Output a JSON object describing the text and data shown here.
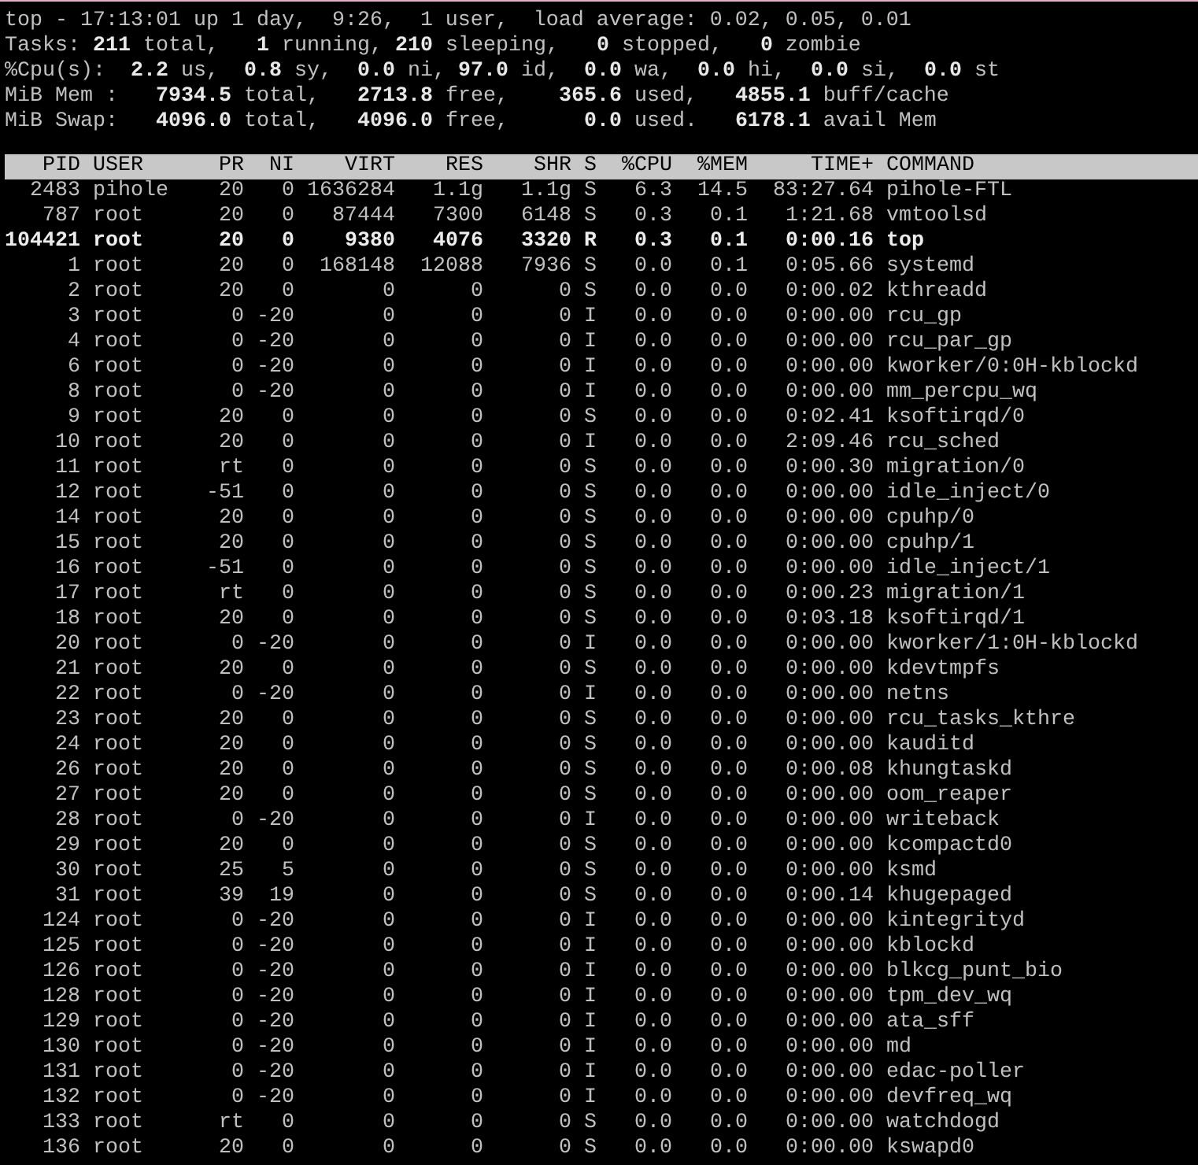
{
  "summary": [
    "top - 17:13:01 up 1 day,  9:26,  1 user,  load average: 0.02, 0.05, 0.01",
    "Tasks: **211** total,   **1** running, **210** sleeping,   **0** stopped,   **0** zombie",
    "%Cpu(s):  **2.2** us,  **0.8** sy,  **0.0** ni, **97.0** id,  **0.0** wa,  **0.0** hi,  **0.0** si,  **0.0** st",
    "MiB Mem :   **7934.5** total,   **2713.8** free,    **365.6** used,   **4855.1** buff/cache",
    "MiB Swap:   **4096.0** total,   **4096.0** free,      **0.0** used.   **6178.1** avail Mem"
  ],
  "table": {
    "columns": [
      "PID",
      "USER",
      "PR",
      "NI",
      "VIRT",
      "RES",
      "SHR",
      "S",
      "%CPU",
      "%MEM",
      "TIME+",
      "COMMAND"
    ],
    "rows": [
      {
        "highlighted": false,
        "cells": [
          "2483",
          "pihole",
          "20",
          "0",
          "1636284",
          "1.1g",
          "1.1g",
          "S",
          "6.3",
          "14.5",
          "83:27.64",
          "pihole-FTL"
        ]
      },
      {
        "highlighted": false,
        "cells": [
          "787",
          "root",
          "20",
          "0",
          "87444",
          "7300",
          "6148",
          "S",
          "0.3",
          "0.1",
          "1:21.68",
          "vmtoolsd"
        ]
      },
      {
        "highlighted": true,
        "cells": [
          "104421",
          "root",
          "20",
          "0",
          "9380",
          "4076",
          "3320",
          "R",
          "0.3",
          "0.1",
          "0:00.16",
          "top"
        ]
      },
      {
        "highlighted": false,
        "cells": [
          "1",
          "root",
          "20",
          "0",
          "168148",
          "12088",
          "7936",
          "S",
          "0.0",
          "0.1",
          "0:05.66",
          "systemd"
        ]
      },
      {
        "highlighted": false,
        "cells": [
          "2",
          "root",
          "20",
          "0",
          "0",
          "0",
          "0",
          "S",
          "0.0",
          "0.0",
          "0:00.02",
          "kthreadd"
        ]
      },
      {
        "highlighted": false,
        "cells": [
          "3",
          "root",
          "0",
          "-20",
          "0",
          "0",
          "0",
          "I",
          "0.0",
          "0.0",
          "0:00.00",
          "rcu_gp"
        ]
      },
      {
        "highlighted": false,
        "cells": [
          "4",
          "root",
          "0",
          "-20",
          "0",
          "0",
          "0",
          "I",
          "0.0",
          "0.0",
          "0:00.00",
          "rcu_par_gp"
        ]
      },
      {
        "highlighted": false,
        "cells": [
          "6",
          "root",
          "0",
          "-20",
          "0",
          "0",
          "0",
          "I",
          "0.0",
          "0.0",
          "0:00.00",
          "kworker/0:0H-kblockd"
        ]
      },
      {
        "highlighted": false,
        "cells": [
          "8",
          "root",
          "0",
          "-20",
          "0",
          "0",
          "0",
          "I",
          "0.0",
          "0.0",
          "0:00.00",
          "mm_percpu_wq"
        ]
      },
      {
        "highlighted": false,
        "cells": [
          "9",
          "root",
          "20",
          "0",
          "0",
          "0",
          "0",
          "S",
          "0.0",
          "0.0",
          "0:02.41",
          "ksoftirqd/0"
        ]
      },
      {
        "highlighted": false,
        "cells": [
          "10",
          "root",
          "20",
          "0",
          "0",
          "0",
          "0",
          "I",
          "0.0",
          "0.0",
          "2:09.46",
          "rcu_sched"
        ]
      },
      {
        "highlighted": false,
        "cells": [
          "11",
          "root",
          "rt",
          "0",
          "0",
          "0",
          "0",
          "S",
          "0.0",
          "0.0",
          "0:00.30",
          "migration/0"
        ]
      },
      {
        "highlighted": false,
        "cells": [
          "12",
          "root",
          "-51",
          "0",
          "0",
          "0",
          "0",
          "S",
          "0.0",
          "0.0",
          "0:00.00",
          "idle_inject/0"
        ]
      },
      {
        "highlighted": false,
        "cells": [
          "14",
          "root",
          "20",
          "0",
          "0",
          "0",
          "0",
          "S",
          "0.0",
          "0.0",
          "0:00.00",
          "cpuhp/0"
        ]
      },
      {
        "highlighted": false,
        "cells": [
          "15",
          "root",
          "20",
          "0",
          "0",
          "0",
          "0",
          "S",
          "0.0",
          "0.0",
          "0:00.00",
          "cpuhp/1"
        ]
      },
      {
        "highlighted": false,
        "cells": [
          "16",
          "root",
          "-51",
          "0",
          "0",
          "0",
          "0",
          "S",
          "0.0",
          "0.0",
          "0:00.00",
          "idle_inject/1"
        ]
      },
      {
        "highlighted": false,
        "cells": [
          "17",
          "root",
          "rt",
          "0",
          "0",
          "0",
          "0",
          "S",
          "0.0",
          "0.0",
          "0:00.23",
          "migration/1"
        ]
      },
      {
        "highlighted": false,
        "cells": [
          "18",
          "root",
          "20",
          "0",
          "0",
          "0",
          "0",
          "S",
          "0.0",
          "0.0",
          "0:03.18",
          "ksoftirqd/1"
        ]
      },
      {
        "highlighted": false,
        "cells": [
          "20",
          "root",
          "0",
          "-20",
          "0",
          "0",
          "0",
          "I",
          "0.0",
          "0.0",
          "0:00.00",
          "kworker/1:0H-kblockd"
        ]
      },
      {
        "highlighted": false,
        "cells": [
          "21",
          "root",
          "20",
          "0",
          "0",
          "0",
          "0",
          "S",
          "0.0",
          "0.0",
          "0:00.00",
          "kdevtmpfs"
        ]
      },
      {
        "highlighted": false,
        "cells": [
          "22",
          "root",
          "0",
          "-20",
          "0",
          "0",
          "0",
          "I",
          "0.0",
          "0.0",
          "0:00.00",
          "netns"
        ]
      },
      {
        "highlighted": false,
        "cells": [
          "23",
          "root",
          "20",
          "0",
          "0",
          "0",
          "0",
          "S",
          "0.0",
          "0.0",
          "0:00.00",
          "rcu_tasks_kthre"
        ]
      },
      {
        "highlighted": false,
        "cells": [
          "24",
          "root",
          "20",
          "0",
          "0",
          "0",
          "0",
          "S",
          "0.0",
          "0.0",
          "0:00.00",
          "kauditd"
        ]
      },
      {
        "highlighted": false,
        "cells": [
          "26",
          "root",
          "20",
          "0",
          "0",
          "0",
          "0",
          "S",
          "0.0",
          "0.0",
          "0:00.08",
          "khungtaskd"
        ]
      },
      {
        "highlighted": false,
        "cells": [
          "27",
          "root",
          "20",
          "0",
          "0",
          "0",
          "0",
          "S",
          "0.0",
          "0.0",
          "0:00.00",
          "oom_reaper"
        ]
      },
      {
        "highlighted": false,
        "cells": [
          "28",
          "root",
          "0",
          "-20",
          "0",
          "0",
          "0",
          "I",
          "0.0",
          "0.0",
          "0:00.00",
          "writeback"
        ]
      },
      {
        "highlighted": false,
        "cells": [
          "29",
          "root",
          "20",
          "0",
          "0",
          "0",
          "0",
          "S",
          "0.0",
          "0.0",
          "0:00.00",
          "kcompactd0"
        ]
      },
      {
        "highlighted": false,
        "cells": [
          "30",
          "root",
          "25",
          "5",
          "0",
          "0",
          "0",
          "S",
          "0.0",
          "0.0",
          "0:00.00",
          "ksmd"
        ]
      },
      {
        "highlighted": false,
        "cells": [
          "31",
          "root",
          "39",
          "19",
          "0",
          "0",
          "0",
          "S",
          "0.0",
          "0.0",
          "0:00.14",
          "khugepaged"
        ]
      },
      {
        "highlighted": false,
        "cells": [
          "124",
          "root",
          "0",
          "-20",
          "0",
          "0",
          "0",
          "I",
          "0.0",
          "0.0",
          "0:00.00",
          "kintegrityd"
        ]
      },
      {
        "highlighted": false,
        "cells": [
          "125",
          "root",
          "0",
          "-20",
          "0",
          "0",
          "0",
          "I",
          "0.0",
          "0.0",
          "0:00.00",
          "kblockd"
        ]
      },
      {
        "highlighted": false,
        "cells": [
          "126",
          "root",
          "0",
          "-20",
          "0",
          "0",
          "0",
          "I",
          "0.0",
          "0.0",
          "0:00.00",
          "blkcg_punt_bio"
        ]
      },
      {
        "highlighted": false,
        "cells": [
          "128",
          "root",
          "0",
          "-20",
          "0",
          "0",
          "0",
          "I",
          "0.0",
          "0.0",
          "0:00.00",
          "tpm_dev_wq"
        ]
      },
      {
        "highlighted": false,
        "cells": [
          "129",
          "root",
          "0",
          "-20",
          "0",
          "0",
          "0",
          "I",
          "0.0",
          "0.0",
          "0:00.00",
          "ata_sff"
        ]
      },
      {
        "highlighted": false,
        "cells": [
          "130",
          "root",
          "0",
          "-20",
          "0",
          "0",
          "0",
          "I",
          "0.0",
          "0.0",
          "0:00.00",
          "md"
        ]
      },
      {
        "highlighted": false,
        "cells": [
          "131",
          "root",
          "0",
          "-20",
          "0",
          "0",
          "0",
          "I",
          "0.0",
          "0.0",
          "0:00.00",
          "edac-poller"
        ]
      },
      {
        "highlighted": false,
        "cells": [
          "132",
          "root",
          "0",
          "-20",
          "0",
          "0",
          "0",
          "I",
          "0.0",
          "0.0",
          "0:00.00",
          "devfreq_wq"
        ]
      },
      {
        "highlighted": false,
        "cells": [
          "133",
          "root",
          "rt",
          "0",
          "0",
          "0",
          "0",
          "S",
          "0.0",
          "0.0",
          "0:00.00",
          "watchdogd"
        ]
      },
      {
        "highlighted": false,
        "cells": [
          "136",
          "root",
          "20",
          "0",
          "0",
          "0",
          "0",
          "S",
          "0.0",
          "0.0",
          "0:00.00",
          "kswapd0"
        ]
      }
    ]
  }
}
